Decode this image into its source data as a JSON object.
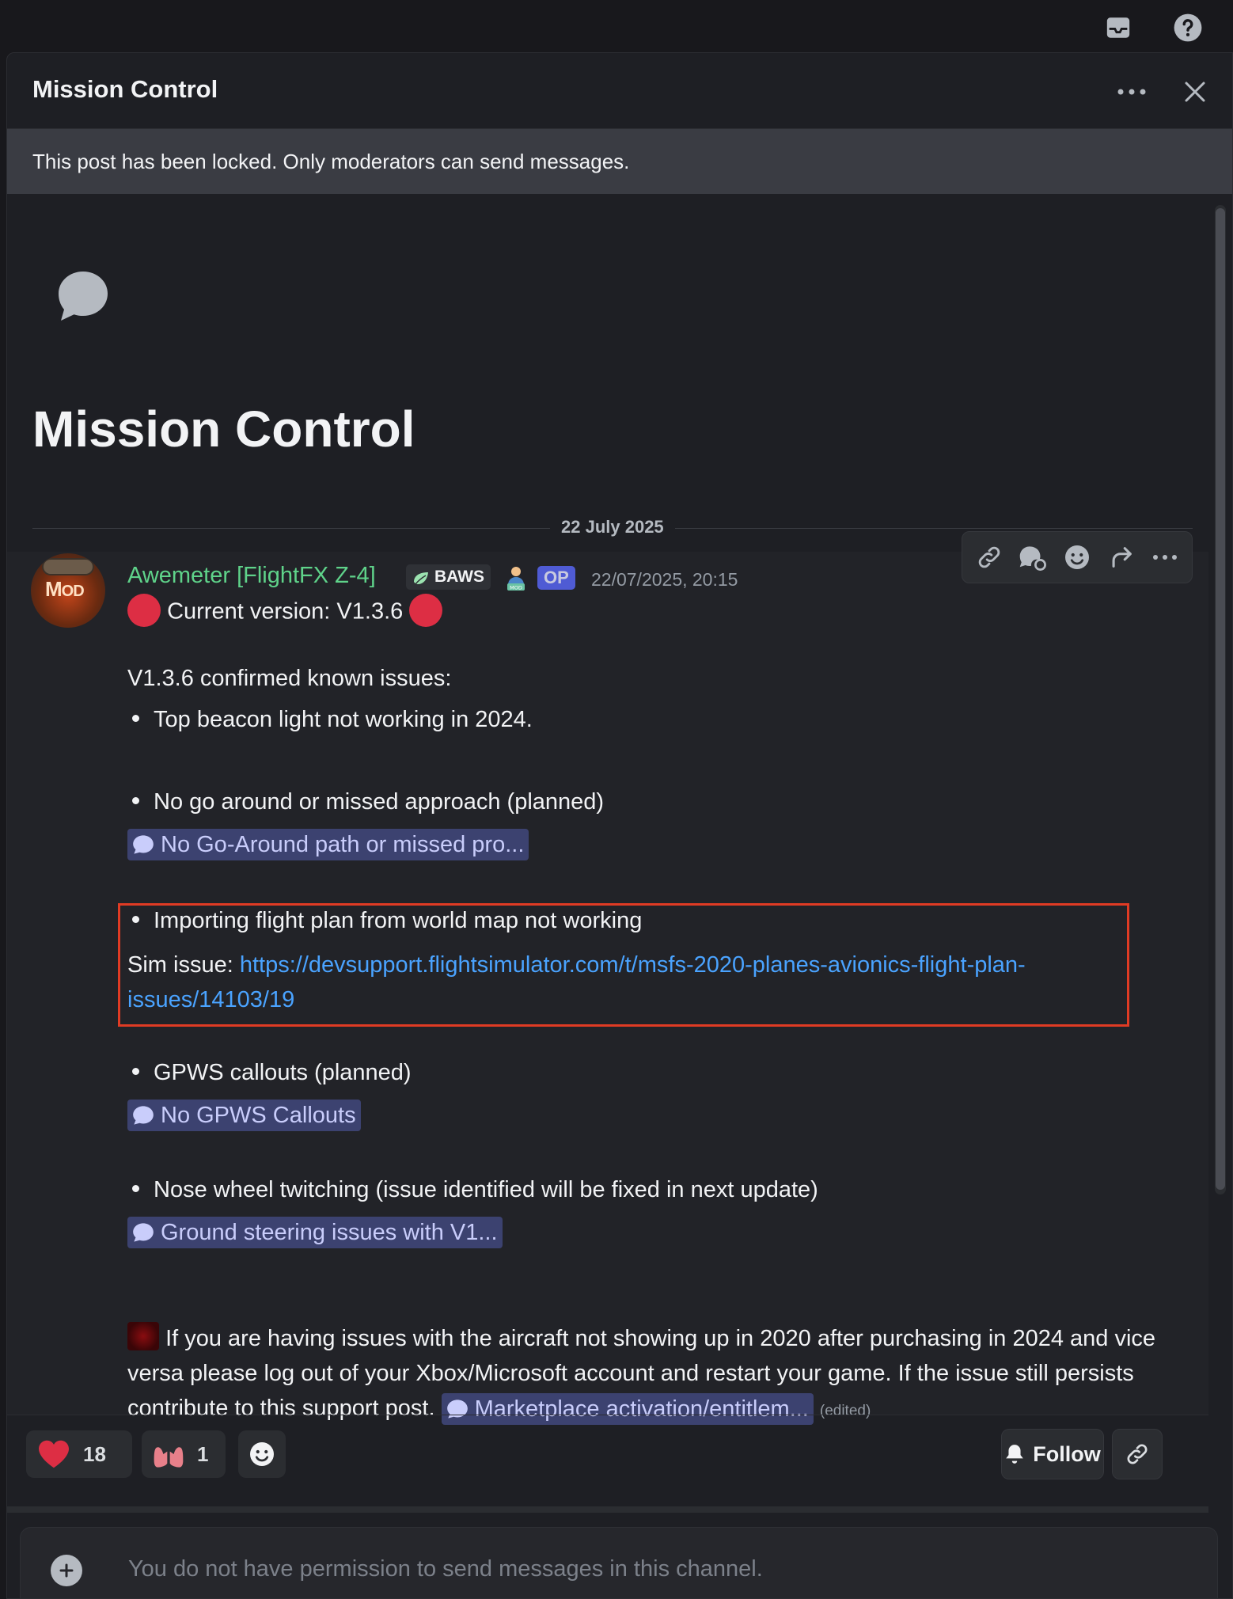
{
  "window": {
    "title": "Mission Control"
  },
  "locked_banner": "This post has been locked. Only moderators can send messages.",
  "thread": {
    "title": "Mission Control",
    "date_divider": "22 July 2025"
  },
  "message": {
    "author": "Awemeter [FlightFX Z-4]",
    "guild_tag": "BAWS",
    "op_badge": "OP",
    "timestamp": "22/07/2025, 20:15",
    "current_version": "Current version: V1.3.6",
    "issues_heading": "V1.3.6 confirmed known issues:",
    "bullets": [
      "Top beacon light not working in 2024.",
      "No go around or missed approach (planned)",
      "Importing flight plan from world map not working",
      "GPWS callouts (planned)",
      "Nose wheel twitching (issue identified will be fixed in next update)"
    ],
    "chips": [
      "No Go-Around path or missed pro...",
      "No GPWS Callouts",
      "Ground steering issues with V1...",
      "Marketplace activation/entitlem..."
    ],
    "sim_issue_label": "Sim issue: ",
    "sim_issue_link": "https://devsupport.flightsimulator.com/t/msfs-2020-planes-avionics-flight-plan-issues/14103/19",
    "final_paragraph": "If you are having issues with the aircraft not showing up in 2020 after purchasing in 2024 and vice versa please log out of your Xbox/Microsoft account and restart your game. If the issue still persists contribute to this support post.",
    "edited": "(edited)"
  },
  "reactions": [
    {
      "icon": "heart-icon",
      "count": "18",
      "color": "#dd2e44"
    },
    {
      "icon": "lungs-icon",
      "count": "1",
      "color": "#e8808a"
    }
  ],
  "follow_label": "Follow",
  "composer_placeholder": "You do not have permission to send messages in this channel.",
  "colors": {
    "username": "#5fd38a",
    "link": "#4aa3ff",
    "chip_bg": "#3c4270",
    "highlight_border": "#e03b24"
  }
}
